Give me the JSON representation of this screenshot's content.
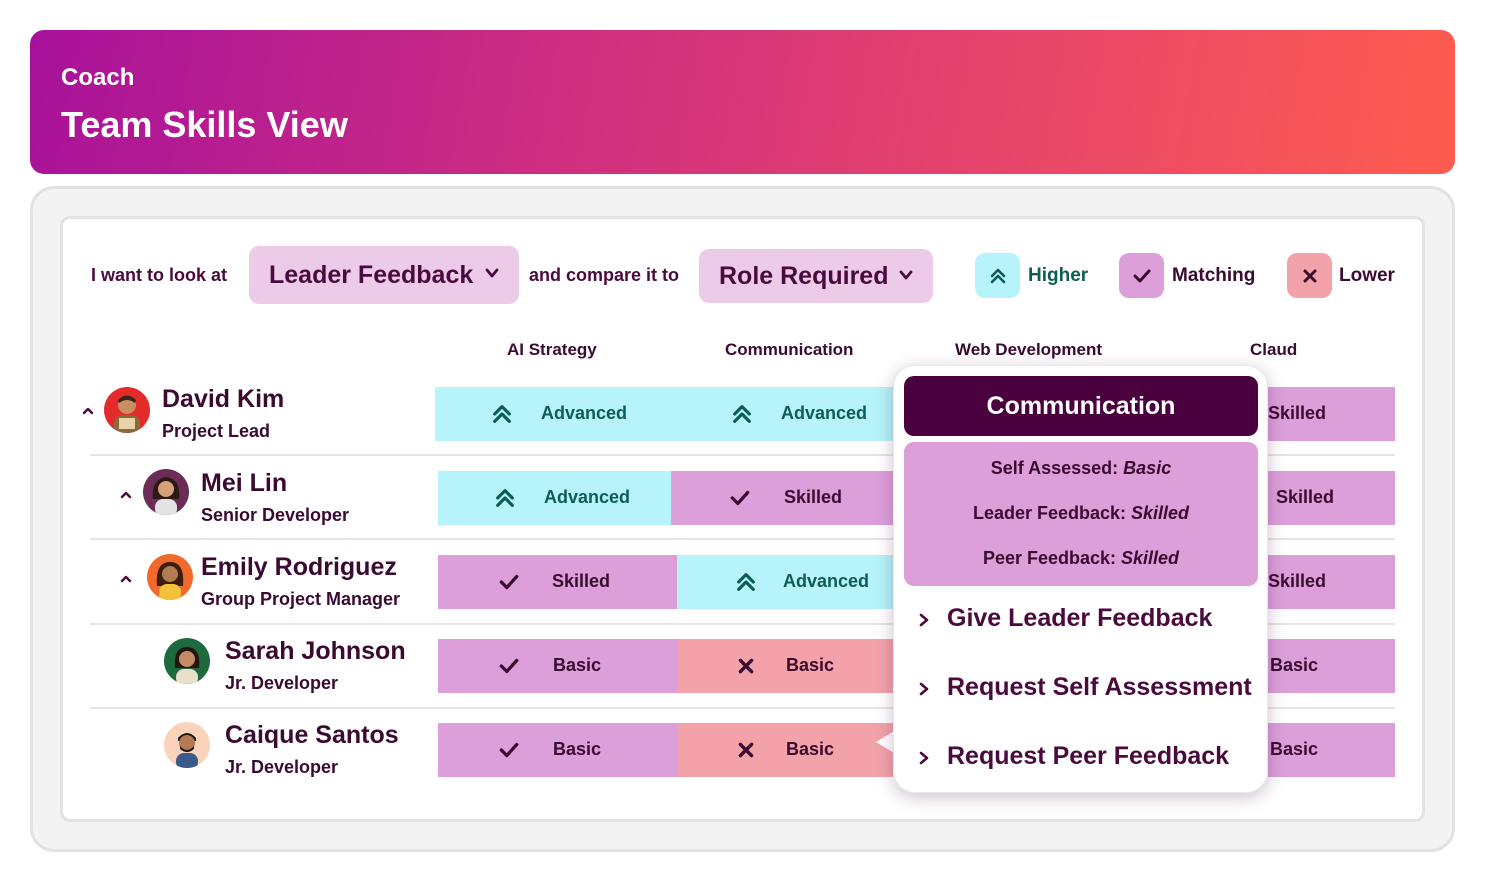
{
  "header": {
    "eyebrow": "Coach",
    "title": "Team Skills View"
  },
  "filters": {
    "look_label": "I want to look at",
    "look_value": "Leader Feedback",
    "compare_label": "and compare it to",
    "compare_value": "Role Required"
  },
  "legend": [
    {
      "label": "Higher",
      "icon": "double-chevron-up-icon",
      "color": "#b6f3fa"
    },
    {
      "label": "Matching",
      "icon": "check-icon",
      "color": "#dc9fda"
    },
    {
      "label": "Lower",
      "icon": "x-icon",
      "color": "#f3a2aa"
    }
  ],
  "columns": [
    "AI Strategy",
    "Communication",
    "Web Development",
    "Claud"
  ],
  "people": [
    {
      "name": "David Kim",
      "role": "Project Lead",
      "cells": [
        {
          "status": "higher",
          "value": "Advanced"
        },
        {
          "status": "higher",
          "value": "Advanced"
        },
        {
          "value": "Skilled"
        }
      ]
    },
    {
      "name": "Mei Lin",
      "role": "Senior Developer",
      "cells": [
        {
          "status": "higher",
          "value": "Advanced"
        },
        {
          "status": "matching",
          "value": "Skilled"
        },
        {
          "value": "Skilled"
        }
      ]
    },
    {
      "name": "Emily Rodriguez",
      "role": "Group Project Manager",
      "cells": [
        {
          "status": "matching",
          "value": "Skilled"
        },
        {
          "status": "higher",
          "value": "Advanced"
        },
        {
          "value": "Skilled"
        }
      ]
    },
    {
      "name": "Sarah Johnson",
      "role": "Jr. Developer",
      "cells": [
        {
          "status": "matching",
          "value": "Basic"
        },
        {
          "status": "lower",
          "value": "Basic"
        },
        {
          "value": "Basic"
        }
      ]
    },
    {
      "name": "Caique Santos",
      "role": "Jr. Developer",
      "cells": [
        {
          "status": "matching",
          "value": "Basic"
        },
        {
          "status": "lower",
          "value": "Basic"
        },
        {
          "value": "Basic"
        }
      ]
    }
  ],
  "popup": {
    "title": "Communication",
    "details": [
      {
        "label": "Self Assessed: ",
        "value": "Basic"
      },
      {
        "label": "Leader Feedback: ",
        "value": "Skilled"
      },
      {
        "label": "Peer Feedback: ",
        "value": "Skilled"
      }
    ],
    "actions": [
      "Give Leader Feedback",
      "Request Self Assessment",
      "Request Peer Feedback"
    ]
  },
  "colors": {
    "brand_dark": "#4a003e",
    "gradient_start": "#a8129a",
    "gradient_end": "#fe5c4e"
  }
}
